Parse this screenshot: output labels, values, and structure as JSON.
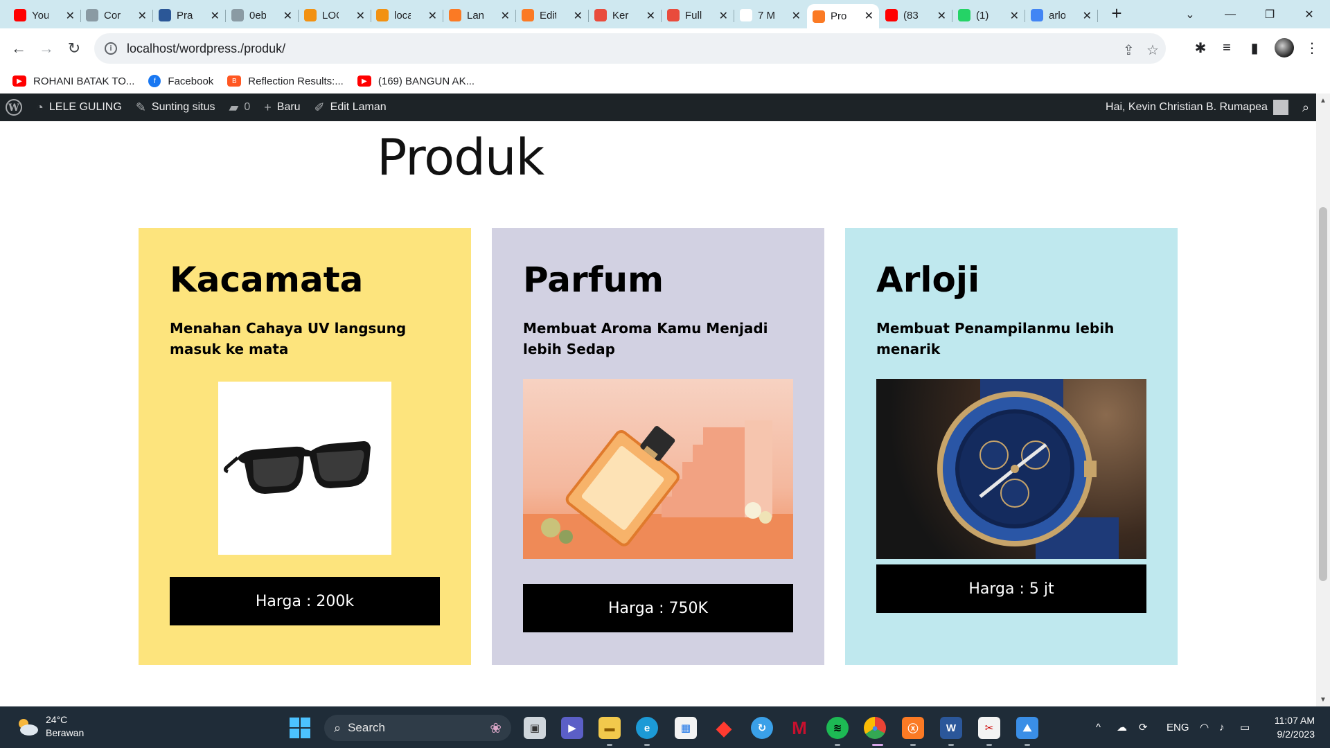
{
  "browser": {
    "tabs": [
      {
        "label": "You",
        "icon": "youtube-icon",
        "color": "#ff0000"
      },
      {
        "label": "Cor",
        "icon": "globe-icon",
        "color": "#8a9aa3"
      },
      {
        "label": "Pra",
        "icon": "del-icon",
        "color": "#2b5797"
      },
      {
        "label": "0eb",
        "icon": "globe-icon",
        "color": "#8a9aa3"
      },
      {
        "label": "LOC",
        "icon": "phpmyadmin-icon",
        "color": "#f29111"
      },
      {
        "label": "loca",
        "icon": "phpmyadmin-icon",
        "color": "#f29111"
      },
      {
        "label": "Lan",
        "icon": "xampp-icon",
        "color": "#fb7a24"
      },
      {
        "label": "Edit",
        "icon": "xampp-icon",
        "color": "#fb7a24"
      },
      {
        "label": "Ker",
        "icon": "rainbow-icon",
        "color": "#e94b3c"
      },
      {
        "label": "Full",
        "icon": "rainbow-icon",
        "color": "#e94b3c"
      },
      {
        "label": "7 M",
        "icon": "k-icon",
        "color": "#ffffff"
      },
      {
        "label": "Pro",
        "icon": "xampp-icon",
        "color": "#fb7a24"
      },
      {
        "label": "(83",
        "icon": "youtube-icon",
        "color": "#ff0000"
      },
      {
        "label": "(1)",
        "icon": "whatsapp-icon",
        "color": "#25d366"
      },
      {
        "label": "arlo",
        "icon": "google-icon",
        "color": "#4285f4"
      }
    ],
    "active_tab_index": 11,
    "url": "localhost/wordpress./produk/",
    "bookmarks": [
      {
        "label": "ROHANI BATAK TO...",
        "icon": "youtube-icon",
        "color": "#ff0000"
      },
      {
        "label": "Facebook",
        "icon": "facebook-icon",
        "color": "#1877f2"
      },
      {
        "label": "Reflection Results:...",
        "icon": "blogger-icon",
        "color": "#ff5722"
      },
      {
        "label": "(169) BANGUN AK...",
        "icon": "youtube-icon",
        "color": "#ff0000"
      }
    ]
  },
  "adminbar": {
    "site_name": "LELE GULING",
    "customize": "Sunting situs",
    "comments_count": "0",
    "new_label": "Baru",
    "edit_label": "Edit Laman",
    "greeting": "Hai, Kevin Christian B. Rumapea"
  },
  "page": {
    "title": "Produk",
    "products": [
      {
        "name": "Kacamata",
        "description": "Menahan Cahaya UV langsung masuk ke mata",
        "price": "Harga : 200k",
        "bg": "#fde47d",
        "image": "sunglasses"
      },
      {
        "name": "Parfum",
        "description": "Membuat Aroma Kamu Menjadi lebih Sedap",
        "price": "Harga : 750K",
        "bg": "#d2d1e2",
        "image": "perfume"
      },
      {
        "name": "Arloji",
        "description": "Membuat Penampilanmu lebih menarik",
        "price": "Harga : 5 jt",
        "bg": "#bfe8ee",
        "image": "watch"
      }
    ]
  },
  "taskbar": {
    "weather_temp": "24°C",
    "weather_desc": "Berawan",
    "search_placeholder": "Search",
    "language": "ENG",
    "time": "11:07 AM",
    "date": "9/2/2023"
  }
}
